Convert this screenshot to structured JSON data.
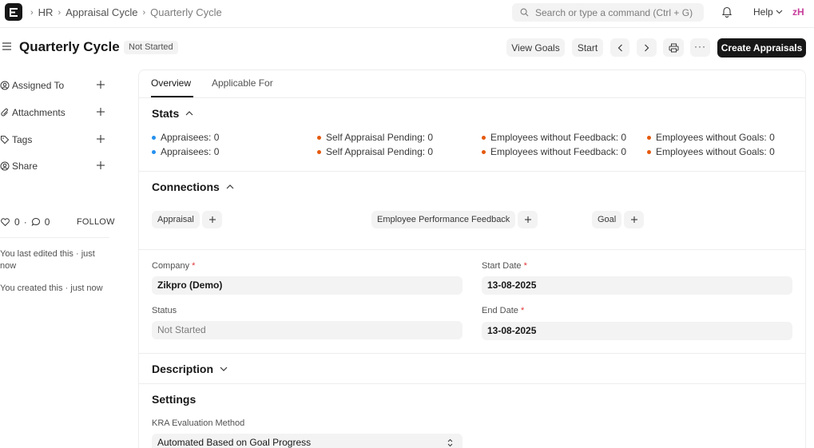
{
  "navbar": {
    "breadcrumbs": [
      "HR",
      "Appraisal Cycle",
      "Quarterly Cycle"
    ],
    "search_placeholder": "Search or type a command (Ctrl + G)",
    "help_label": "Help",
    "avatar_initials": "zH"
  },
  "header": {
    "title": "Quarterly Cycle",
    "status": "Not Started",
    "buttons": {
      "view_goals": "View Goals",
      "start": "Start",
      "create_appraisals": "Create Appraisals"
    }
  },
  "sidebar": {
    "items": [
      {
        "label": "Assigned To",
        "icon": "user-add-icon"
      },
      {
        "label": "Attachments",
        "icon": "paperclip-icon"
      },
      {
        "label": "Tags",
        "icon": "tag-icon"
      },
      {
        "label": "Share",
        "icon": "share-icon"
      }
    ],
    "likes": "0",
    "comments": "0",
    "follow_label": "FOLLOW",
    "activity": [
      "You last edited this · just now",
      "You created this · just now"
    ]
  },
  "tabs": [
    "Overview",
    "Applicable For"
  ],
  "stats": {
    "title": "Stats",
    "rows": [
      [
        {
          "label": "Appraisees: 0",
          "color": "#2490ef"
        },
        {
          "label": "Self Appraisal Pending: 0",
          "color": "#e5590d"
        },
        {
          "label": "Employees without Feedback: 0",
          "color": "#e5590d"
        },
        {
          "label": "Employees without Goals: 0",
          "color": "#e5590d"
        }
      ],
      [
        {
          "label": "Appraisees: 0",
          "color": "#2490ef"
        },
        {
          "label": "Self Appraisal Pending: 0",
          "color": "#e5590d"
        },
        {
          "label": "Employees without Feedback: 0",
          "color": "#e5590d"
        },
        {
          "label": "Employees without Goals: 0",
          "color": "#e5590d"
        }
      ]
    ]
  },
  "connections": {
    "title": "Connections",
    "items": [
      "Appraisal",
      "Employee Performance Feedback",
      "Goal"
    ]
  },
  "form": {
    "company_label": "Company",
    "company_value": "Zikpro (Demo)",
    "start_date_label": "Start Date",
    "start_date_value": "13-08-2025",
    "status_label": "Status",
    "status_value": "Not Started",
    "end_date_label": "End Date",
    "end_date_value": "13-08-2025"
  },
  "description": {
    "title": "Description"
  },
  "settings": {
    "title": "Settings",
    "kra_label": "KRA Evaluation Method",
    "kra_value": "Automated Based on Goal Progress"
  },
  "colors": {
    "primary": "#171717",
    "required": "#e03636",
    "avatar": "#c73e9b"
  }
}
